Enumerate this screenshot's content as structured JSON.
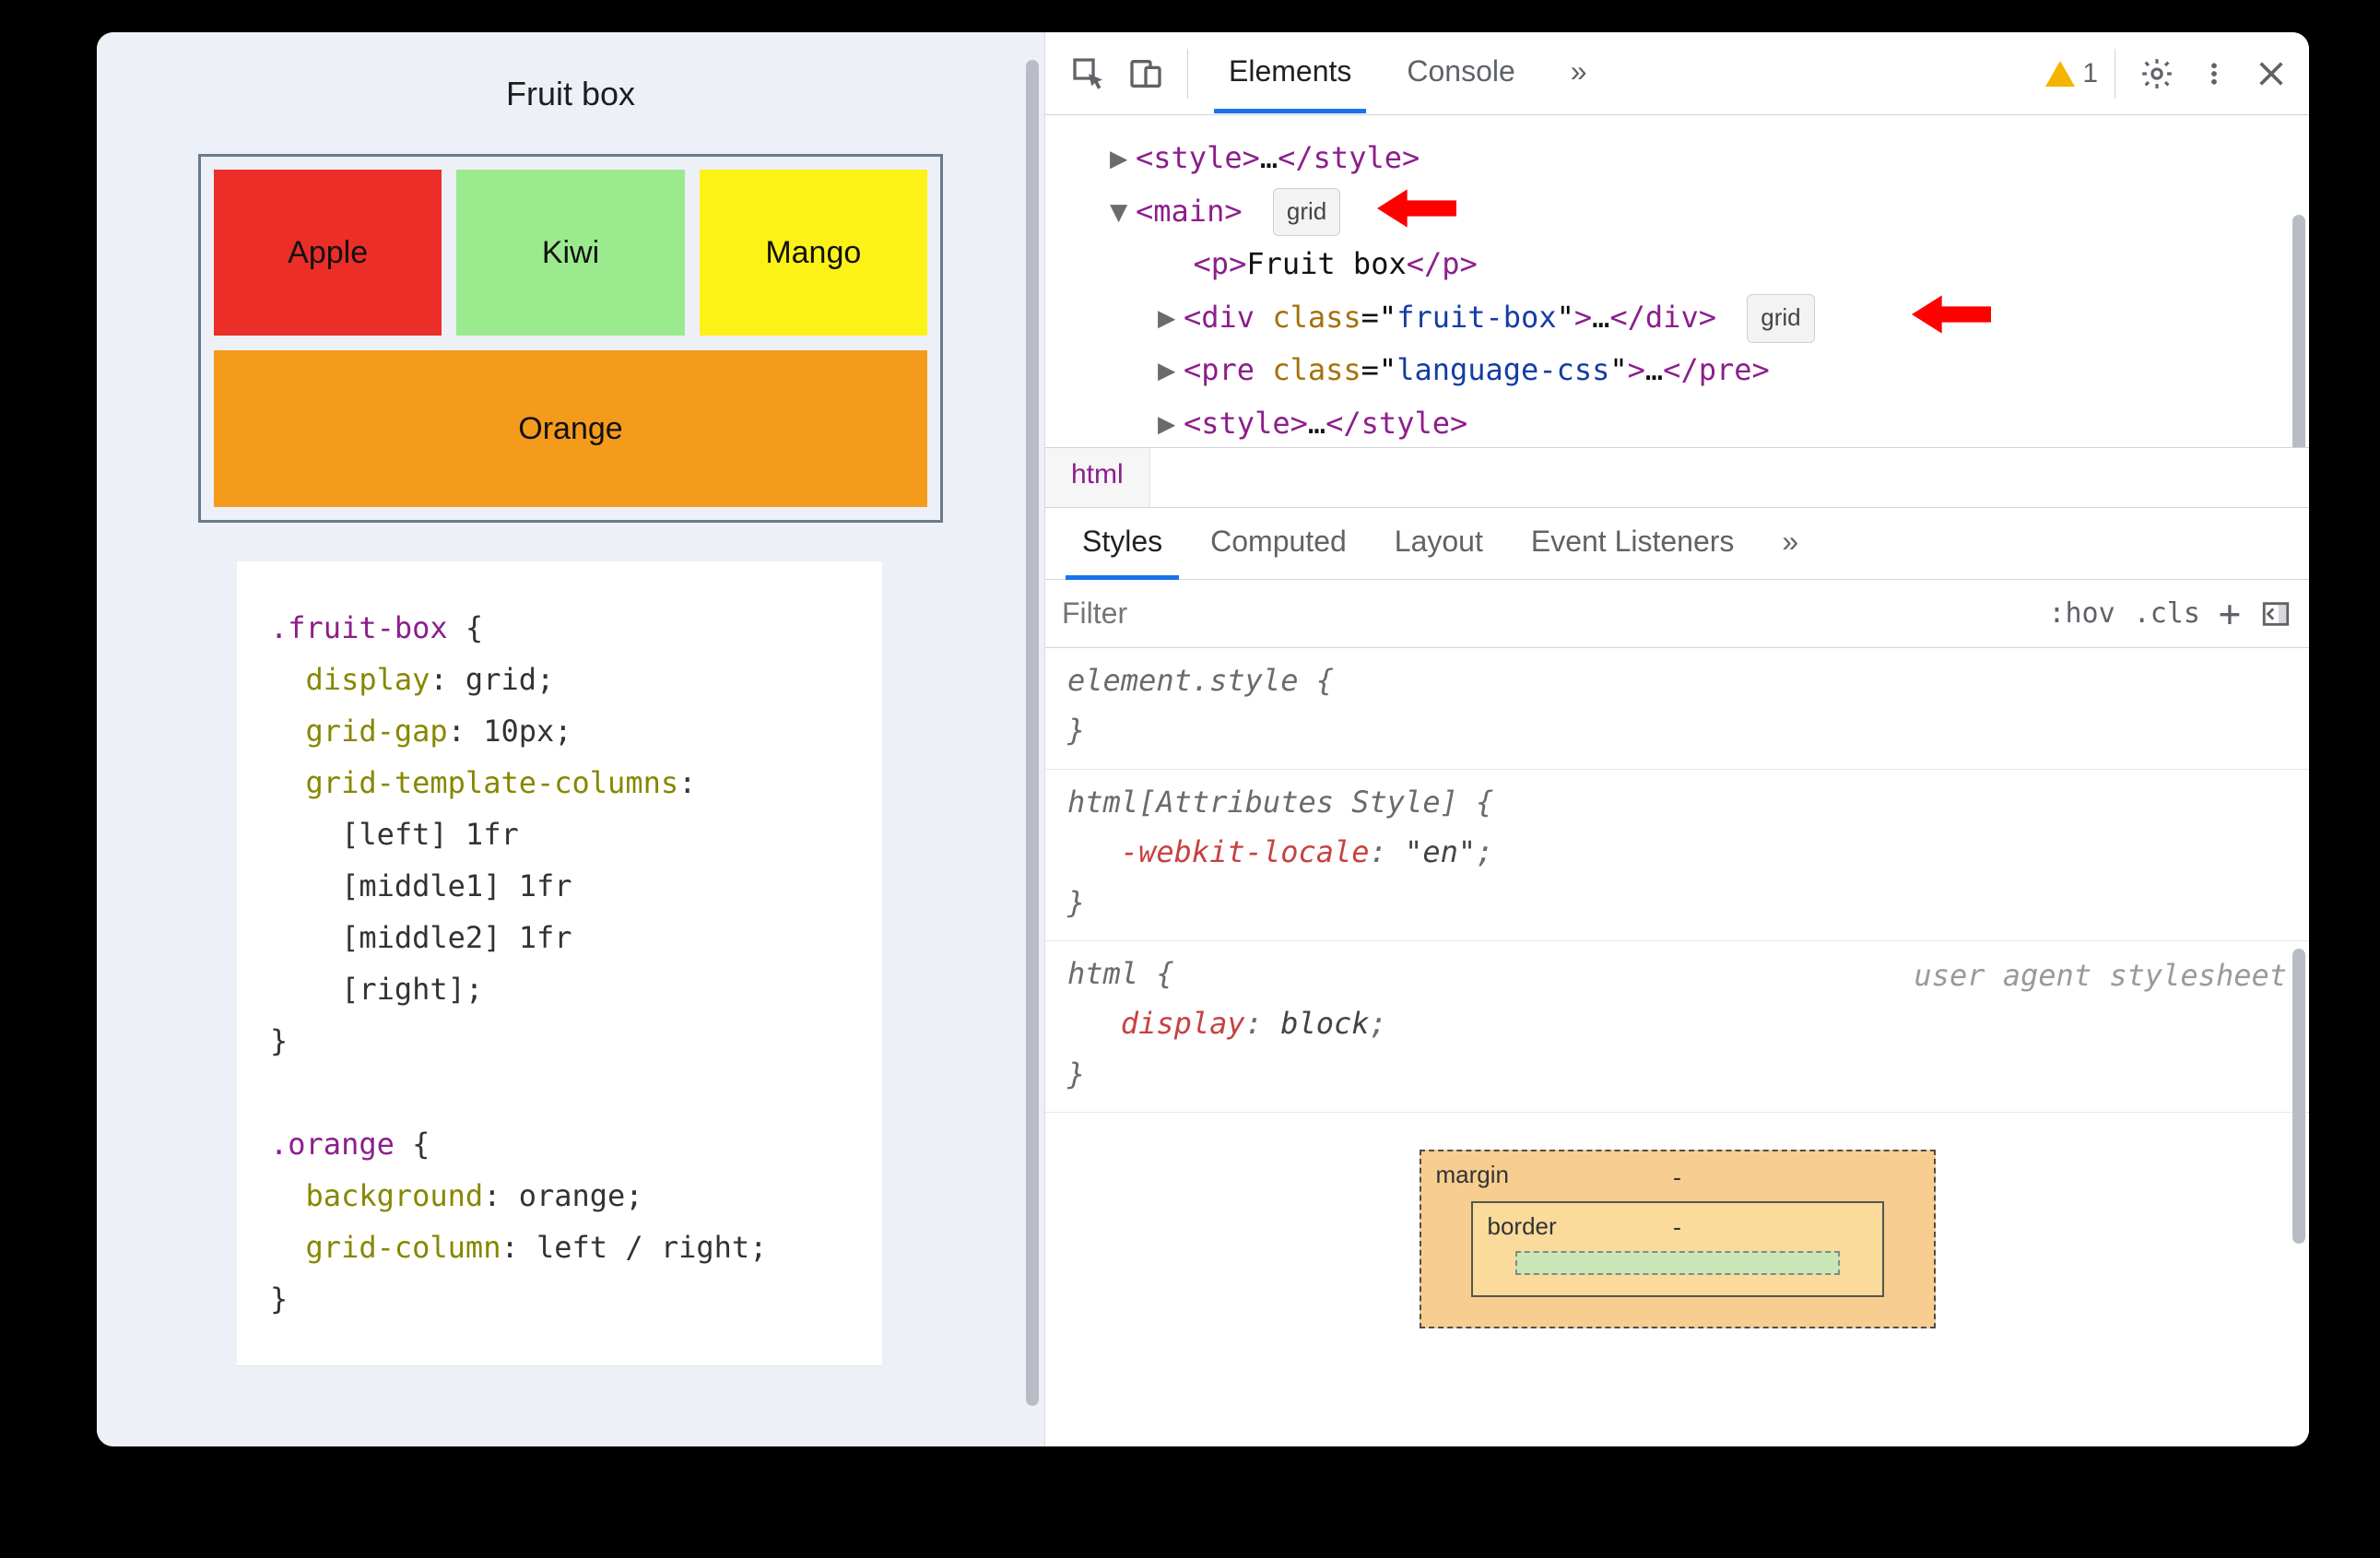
{
  "left": {
    "title": "Fruit box",
    "fruits": {
      "apple": "Apple",
      "kiwi": "Kiwi",
      "mango": "Mango",
      "orange": "Orange"
    },
    "code": {
      "sel_fruit": ".fruit-box",
      "p_display": "display",
      "v_display": "grid",
      "p_gap": "grid-gap",
      "v_gap": "10px",
      "p_cols": "grid-template-columns",
      "cols_l1": "[left] 1fr",
      "cols_l2": "[middle1] 1fr",
      "cols_l3": "[middle2] 1fr",
      "cols_l4": "[right]",
      "sel_orange": ".orange",
      "p_bg": "background",
      "v_bg": "orange",
      "p_gc": "grid-column",
      "v_gc": "left / right"
    }
  },
  "devtools": {
    "tabs": {
      "elements": "Elements",
      "console": "Console",
      "more": "»"
    },
    "warn_count": "1",
    "tree": {
      "style1": "<style>…</style>",
      "main_open": "main",
      "badge_grid": "grid",
      "p_text": "Fruit box",
      "div_class": "fruit-box",
      "pre_class": "language-css",
      "style2": "<style>…</style>"
    },
    "breadcrumb": "html",
    "style_tabs": {
      "styles": "Styles",
      "computed": "Computed",
      "layout": "Layout",
      "events": "Event Listeners",
      "more": "»"
    },
    "filter_placeholder": "Filter",
    "filter_btns": {
      "hov": ":hov",
      "cls": ".cls",
      "plus": "+"
    },
    "rules": {
      "element_style": "element.style {",
      "close": "}",
      "attr_sel": "html[Attributes Style] {",
      "locale_prop": "-webkit-locale",
      "locale_val": "\"en\"",
      "html_sel": "html {",
      "display_prop": "display",
      "display_val": "block",
      "ua_label": "user agent stylesheet"
    },
    "boxmodel": {
      "margin": "margin",
      "border": "border",
      "dash": "-"
    }
  }
}
